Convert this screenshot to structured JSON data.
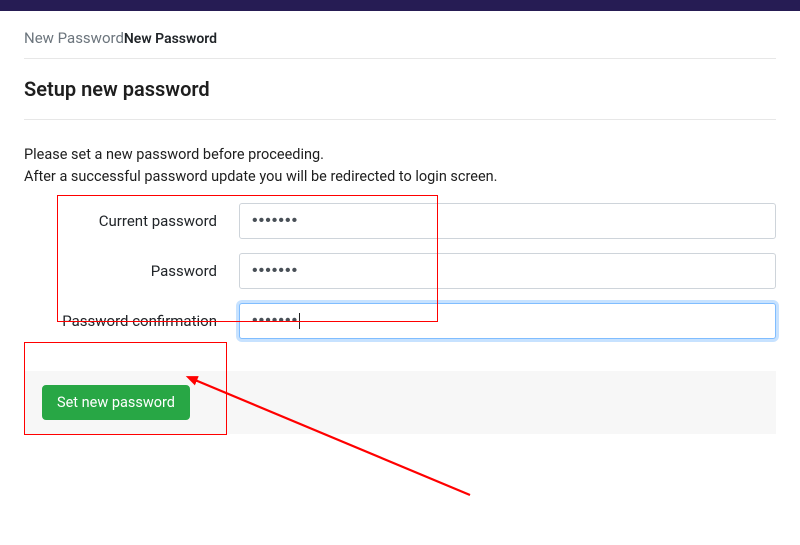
{
  "breadcrumb": {
    "parent": "New Password",
    "current": "New Password"
  },
  "page": {
    "title": "Setup new password"
  },
  "intro": {
    "line1": "Please set a new password before proceeding.",
    "line2": "After a successful password update you will be redirected to login screen."
  },
  "form": {
    "current_password": {
      "label": "Current password",
      "value": "•••••••"
    },
    "password": {
      "label": "Password",
      "value": "•••••••"
    },
    "password_confirmation": {
      "label": "Password confirmation",
      "value": "•••••••"
    }
  },
  "actions": {
    "submit_label": "Set new password"
  },
  "colors": {
    "topbar": "#261c54",
    "button": "#28a745",
    "annotation": "#ff0000",
    "focus": "#80bdff"
  }
}
